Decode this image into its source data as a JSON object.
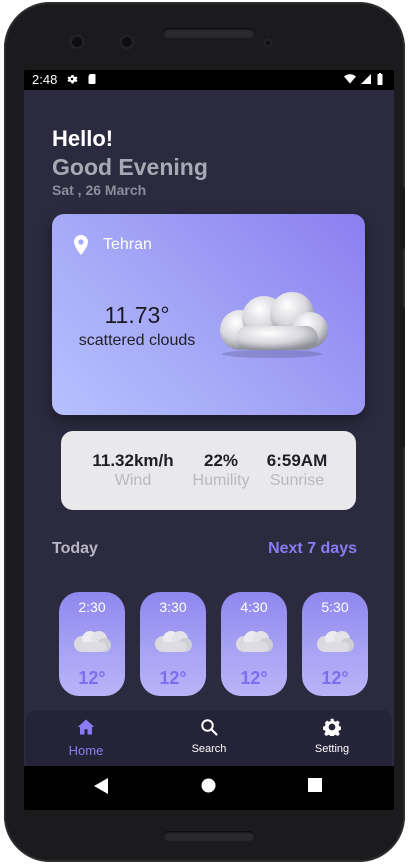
{
  "status_bar": {
    "time": "2:48",
    "left_icons": [
      "gear-icon",
      "sim-card-icon"
    ],
    "right_icons": [
      "wifi-icon",
      "signal-icon",
      "battery-icon"
    ]
  },
  "header": {
    "greeting": "Hello!",
    "subgreeting": "Good Evening",
    "date": "Sat , 26 March"
  },
  "weather_card": {
    "city": "Tehran",
    "temperature": "11.73°",
    "condition": "scattered clouds",
    "icon": "cloud-icon"
  },
  "stats": [
    {
      "value": "11.32km/h",
      "label": "Wind"
    },
    {
      "value": "22%",
      "label": "Humility"
    },
    {
      "value": "6:59AM",
      "label": "Sunrise"
    }
  ],
  "forecast": {
    "title": "Today",
    "link": "Next 7 days",
    "hours": [
      {
        "time": "2:30",
        "temp": "12°"
      },
      {
        "time": "3:30",
        "temp": "12°"
      },
      {
        "time": "4:30",
        "temp": "12°"
      },
      {
        "time": "5:30",
        "temp": "12°"
      }
    ]
  },
  "bottom_nav": {
    "items": [
      {
        "label": "Home",
        "icon": "home-icon",
        "active": true
      },
      {
        "label": "Search",
        "icon": "search-icon",
        "active": false
      },
      {
        "label": "Setting",
        "icon": "gear-icon",
        "active": false
      }
    ]
  },
  "system_nav": [
    "back-icon",
    "home-circle-icon",
    "recents-icon"
  ],
  "colors": {
    "background": "#2b2a3f",
    "accent": "#8c7cf3",
    "card_gradient_start": "#b6c1ff",
    "card_gradient_end": "#8b7ef0",
    "stats_card": "#e9e9ec"
  }
}
